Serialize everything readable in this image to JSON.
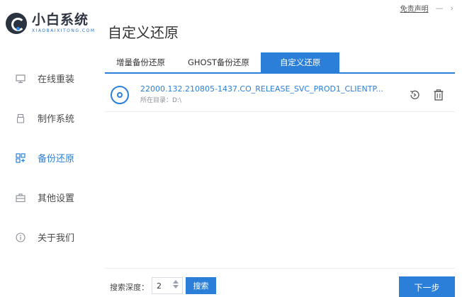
{
  "logo": {
    "cn": "小白系统",
    "en": "XIAOBAIXITONG.COM"
  },
  "header": {
    "title": "自定义还原",
    "disclaimer": "免责声明",
    "minimize": "—",
    "close": "›"
  },
  "sidebar": {
    "items": [
      {
        "label": "在线重装",
        "icon": "monitor-icon"
      },
      {
        "label": "制作系统",
        "icon": "usb-icon"
      },
      {
        "label": "备份还原",
        "icon": "backup-grid-icon",
        "active": true
      },
      {
        "label": "其他设置",
        "icon": "briefcase-icon"
      },
      {
        "label": "关于我们",
        "icon": "info-icon"
      }
    ]
  },
  "tabs": [
    {
      "label": "增量备份还原"
    },
    {
      "label": "GHOST备份还原"
    },
    {
      "label": "自定义还原",
      "active": true
    }
  ],
  "file": {
    "name": "22000.132.210805-1437.CO_RELEASE_SVC_PROD1_CLIENTP...",
    "dir": "所在目录：D:\\"
  },
  "bottom": {
    "depth_label": "搜索深度：",
    "depth_value": "2",
    "search_label": "搜索",
    "next_label": "下一步"
  },
  "colors": {
    "accent": "#2b7fd8",
    "text": "#333333",
    "muted": "#8a8f98"
  }
}
